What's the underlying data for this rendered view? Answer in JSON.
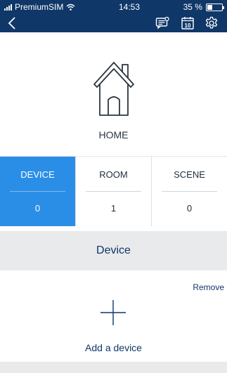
{
  "status_bar": {
    "carrier": "PremiumSIM",
    "time": "14:53",
    "battery": "35 %",
    "battery_level": 0.35
  },
  "nav": {
    "back_icon": "chevron-left-icon",
    "icons": [
      "message-icon",
      "calendar-icon",
      "gear-icon"
    ],
    "calendar_day": "10"
  },
  "home": {
    "icon": "house-icon",
    "label": "HOME"
  },
  "tabs": [
    {
      "label": "DEVICE",
      "count": "0",
      "active": true
    },
    {
      "label": "ROOM",
      "count": "1",
      "active": false
    },
    {
      "label": "SCENE",
      "count": "0",
      "active": false
    }
  ],
  "section": {
    "title": "Device",
    "remove_label": "Remove"
  },
  "add": {
    "icon": "plus-icon",
    "label": "Add a device"
  },
  "colors": {
    "nav_bg": "#0f3768",
    "accent": "#2b8ee6",
    "section_bg": "#e9eaec"
  }
}
